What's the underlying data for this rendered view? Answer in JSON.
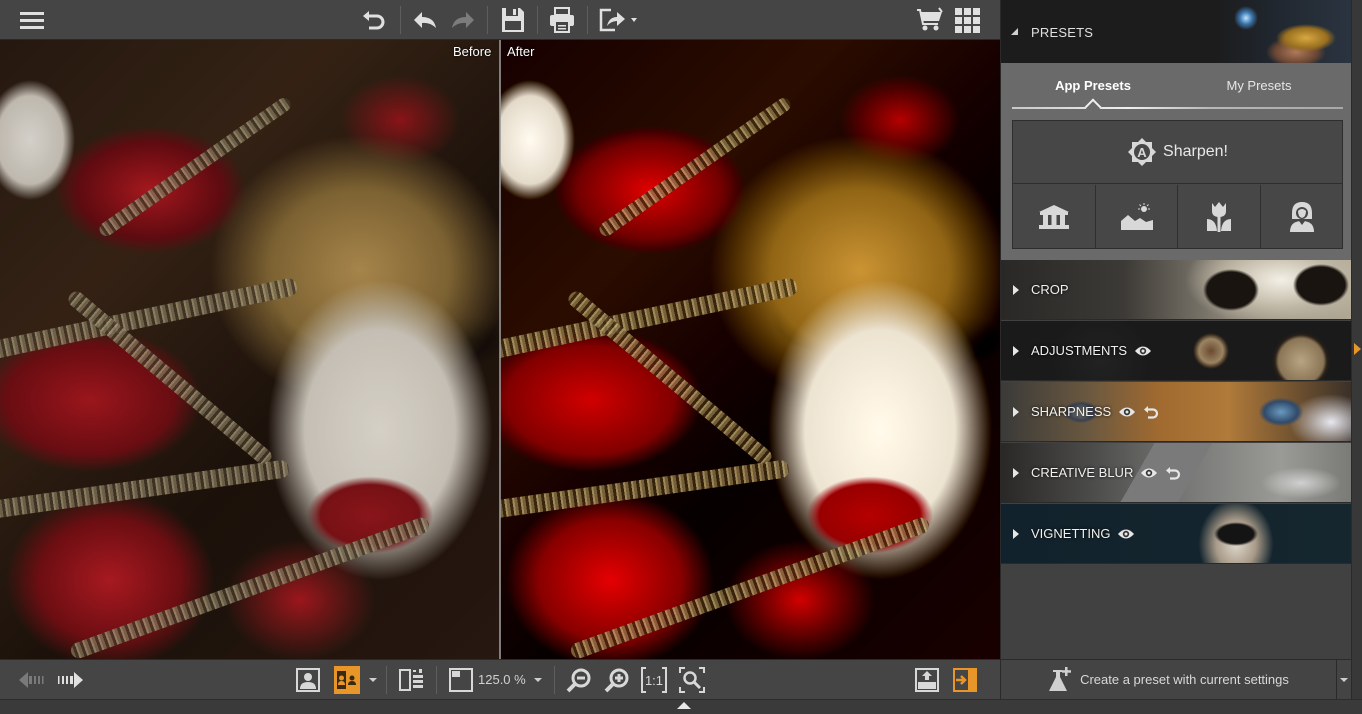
{
  "toolbar": {
    "icons": [
      "menu-icon",
      "undo-all-icon",
      "undo-icon",
      "redo-icon",
      "save-icon",
      "print-icon",
      "share-icon",
      "cart-icon",
      "grid-icon"
    ]
  },
  "canvas": {
    "before_label": "Before",
    "after_label": "After"
  },
  "bottombar": {
    "zoom_value": "125.0 %",
    "icons": [
      "previous-image-icon",
      "next-image-icon",
      "single-view-icon",
      "split-view-icon",
      "compare-toggle-icon",
      "navigator-icon",
      "zoom-out-icon",
      "zoom-in-icon",
      "zoom-1to1-icon",
      "zoom-fit-icon",
      "export-icon",
      "panel-toggle-icon"
    ],
    "accent_color": "#e8952a"
  },
  "panel": {
    "presets_title": "PRESETS",
    "tabs": [
      {
        "label": "App Presets",
        "active": true
      },
      {
        "label": "My Presets",
        "active": false
      }
    ],
    "sharpen_label": "Sharpen!",
    "categories": [
      "architecture-icon",
      "landscape-icon",
      "nature-icon",
      "portrait-icon"
    ],
    "sections": [
      {
        "label": "CROP",
        "eye": false,
        "reset": false
      },
      {
        "label": "ADJUSTMENTS",
        "eye": true,
        "reset": false
      },
      {
        "label": "SHARPNESS",
        "eye": true,
        "reset": true
      },
      {
        "label": "CREATIVE BLUR",
        "eye": true,
        "reset": true
      },
      {
        "label": "VIGNETTING",
        "eye": true,
        "reset": false
      }
    ],
    "create_preset_label": "Create a preset with current settings"
  }
}
